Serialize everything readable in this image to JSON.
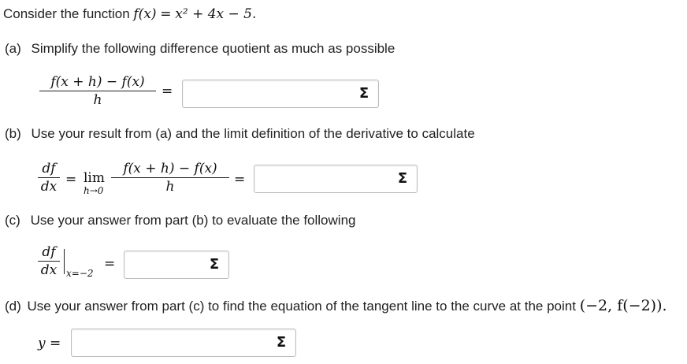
{
  "intro": {
    "prefix": "Consider the function",
    "function_lhs": "f(x)",
    "eq": "=",
    "function_rhs": "x² + 4x − 5."
  },
  "part_a": {
    "label": "(a)",
    "text": "Simplify the following difference quotient as much as possible",
    "numerator": "f(x + h) − f(x)",
    "denominator": "h",
    "eq": "=",
    "input_value": "",
    "sigma_icon": "Σ"
  },
  "part_b": {
    "label": "(b)",
    "text": "Use your result from (a) and the limit definition of the derivative to calculate",
    "d_num": "df",
    "d_den": "dx",
    "eq1": "=",
    "lim": "lim",
    "lim_sub": "h→0",
    "numerator": "f(x + h) − f(x)",
    "denominator": "h",
    "eq2": "=",
    "input_value": "",
    "sigma_icon": "Σ"
  },
  "part_c": {
    "label": "(c)",
    "text": "Use your answer from part (b) to evaluate the following",
    "d_num": "df",
    "d_den": "dx",
    "eval_sub": "x=−2",
    "eq": "=",
    "input_value": "",
    "sigma_icon": "Σ"
  },
  "part_d": {
    "label": "(d)",
    "text": "Use your answer from part (c) to find the equation of the tangent line to the curve at the point",
    "point": "(−2, f(−2)).",
    "y_label": "y =",
    "input_value": "",
    "sigma_icon": "Σ"
  }
}
